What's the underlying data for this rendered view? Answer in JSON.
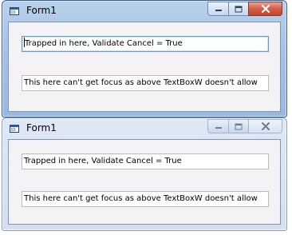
{
  "windows": [
    {
      "title": "Form1",
      "state": "active",
      "textbox_top": "Trapped in here, Validate Cancel = True",
      "textbox_bottom": "This here can't get focus as above TextBoxW doesn't allow"
    },
    {
      "title": "Form1",
      "state": "inactive",
      "textbox_top": "Trapped in here, Validate Cancel = True",
      "textbox_bottom": "This here can't get focus as above TextBoxW doesn't allow"
    }
  ],
  "icons": {
    "app": "form-window-icon",
    "minimize": "minimize-icon",
    "maximize": "maximize-icon",
    "close": "close-icon"
  },
  "colors": {
    "active_close": "#c7432a",
    "client_bg": "#f5f2f5",
    "focus_border": "#5f9bd2"
  }
}
